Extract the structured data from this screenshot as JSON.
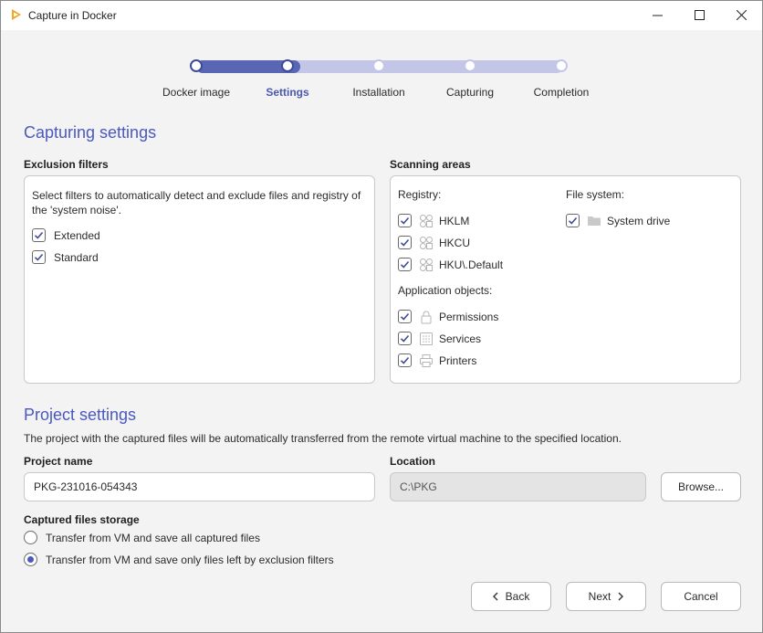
{
  "window": {
    "title": "Capture in Docker"
  },
  "stepper": {
    "steps": [
      {
        "label": "Docker image"
      },
      {
        "label": "Settings"
      },
      {
        "label": "Installation"
      },
      {
        "label": "Capturing"
      },
      {
        "label": "Completion"
      }
    ],
    "active_index": 1
  },
  "capturing": {
    "title": "Capturing settings",
    "exclusion": {
      "label": "Exclusion filters",
      "description": "Select filters to automatically detect and exclude files and registry of the 'system noise'.",
      "filters": [
        {
          "label": "Extended",
          "checked": true
        },
        {
          "label": "Standard",
          "checked": true
        }
      ]
    },
    "scanning": {
      "label": "Scanning areas",
      "registry_label": "Registry:",
      "registry": [
        {
          "label": "HKLM",
          "icon": "registry-icon",
          "checked": true
        },
        {
          "label": "HKCU",
          "icon": "registry-icon",
          "checked": true
        },
        {
          "label": "HKU\\.Default",
          "icon": "registry-icon",
          "checked": true
        }
      ],
      "filesystem_label": "File system:",
      "filesystem": [
        {
          "label": "System drive",
          "icon": "folder-icon",
          "checked": true
        }
      ],
      "appobjects_label": "Application objects:",
      "appobjects": [
        {
          "label": "Permissions",
          "icon": "lock-icon",
          "checked": true
        },
        {
          "label": "Services",
          "icon": "services-icon",
          "checked": true
        },
        {
          "label": "Printers",
          "icon": "printer-icon",
          "checked": true
        }
      ]
    }
  },
  "project": {
    "title": "Project settings",
    "description": "The project with the captured files will be automatically transferred from the remote virtual machine to the specified location.",
    "name_label": "Project name",
    "name_value": "PKG-231016-054343",
    "location_label": "Location",
    "location_value": "C:\\PKG",
    "browse_label": "Browse...",
    "storage_label": "Captured files storage",
    "storage_options": [
      {
        "label": "Transfer from VM and save all captured files",
        "selected": false
      },
      {
        "label": "Transfer from VM and save only files left by exclusion filters",
        "selected": true
      }
    ]
  },
  "footer": {
    "back_label": "Back",
    "next_label": "Next",
    "cancel_label": "Cancel"
  },
  "colors": {
    "accent": "#4a58c0",
    "stepper_done": "#5866b4",
    "stepper_todo": "#c3c6e6"
  }
}
